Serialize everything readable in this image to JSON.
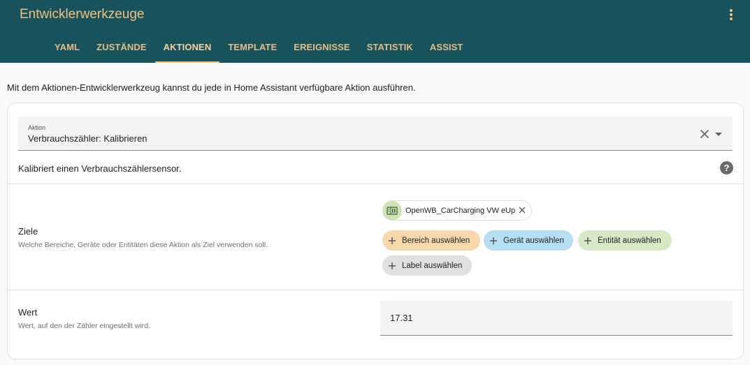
{
  "header": {
    "title": "Entwicklerwerkzeuge",
    "tabs": [
      {
        "label": "YAML",
        "active": false
      },
      {
        "label": "Zustände",
        "active": false
      },
      {
        "label": "Aktionen",
        "active": true
      },
      {
        "label": "Template",
        "active": false
      },
      {
        "label": "Ereignisse",
        "active": false
      },
      {
        "label": "Statistik",
        "active": false
      },
      {
        "label": "Assist",
        "active": false
      }
    ]
  },
  "intro": "Mit dem Aktionen-Entwicklerwerkzeug kannst du jede in Home Assistant verfügbare Aktion ausführen.",
  "action": {
    "label": "Aktion",
    "value": "Verbrauchszähler: Kalibrieren",
    "description": "Kalibriert einen Verbrauchszählersensor."
  },
  "targets": {
    "title": "Ziele",
    "subtitle": "Welche Bereiche, Geräte oder Entitäten diese Aktion als Ziel verwenden soll.",
    "selected_entity": "OpenWB_CarCharging VW eUp",
    "pickers": {
      "area": "Bereich auswählen",
      "device": "Gerät auswählen",
      "entity": "Entität auswählen",
      "label": "Label auswählen"
    }
  },
  "value_field": {
    "title": "Wert",
    "subtitle": "Wert, auf den der Zähler eingestellt wird.",
    "value": "17.31"
  },
  "colors": {
    "header_bg": "#18525c",
    "accent": "#f1c27d",
    "area_chip": "#f7d8ad",
    "device_chip": "#b6dff4",
    "entity_chip": "#d6e9c4",
    "label_chip": "#e0e0e0"
  },
  "icons": {
    "menu": "more-vert-icon",
    "clear": "close-icon",
    "dropdown": "chevron-down-icon",
    "help": "help-circle-icon",
    "entity": "meter-icon",
    "add": "plus-icon"
  }
}
